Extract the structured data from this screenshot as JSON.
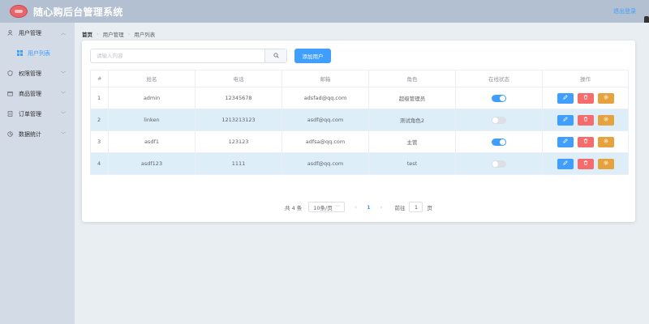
{
  "header": {
    "title": "随心购后台管理系统",
    "logout_label": "退出登录"
  },
  "sidebar": {
    "items": [
      {
        "label": "用户管理",
        "icon": "user-icon",
        "expanded": true,
        "children": [
          {
            "label": "用户列表",
            "icon": "grid-icon",
            "active": true
          }
        ]
      },
      {
        "label": "权限管理",
        "icon": "shield-icon"
      },
      {
        "label": "商品管理",
        "icon": "box-icon"
      },
      {
        "label": "订单管理",
        "icon": "document-icon"
      },
      {
        "label": "数据统计",
        "icon": "chart-icon"
      }
    ]
  },
  "breadcrumb": {
    "home": "首页",
    "level1": "用户管理",
    "level2": "用户列表"
  },
  "search": {
    "placeholder": "请输入内容",
    "value": ""
  },
  "add_button_label": "添加用户",
  "table": {
    "columns": [
      "#",
      "姓名",
      "电话",
      "邮箱",
      "角色",
      "在线状态",
      "操作"
    ],
    "rows": [
      {
        "index": "1",
        "name": "admin",
        "phone": "12345678",
        "email": "adsfad@qq.com",
        "role": "超级管理员",
        "online": true
      },
      {
        "index": "2",
        "name": "linken",
        "phone": "1213213123",
        "email": "asdf@qq.com",
        "role": "测试角色2",
        "online": false
      },
      {
        "index": "3",
        "name": "asdf1",
        "phone": "123123",
        "email": "adfsa@qq.com",
        "role": "主管",
        "online": true
      },
      {
        "index": "4",
        "name": "asdf123",
        "phone": "1111",
        "email": "asdf@qq.com",
        "role": "test",
        "online": false
      }
    ]
  },
  "pagination": {
    "total_text": "共 4 条",
    "page_size_text": "10条/页",
    "current_page": "1",
    "goto_label": "前往",
    "goto_value": "1",
    "page_unit": "页"
  },
  "colors": {
    "header_bg": "#b3c0d1",
    "sidebar_bg": "#d3dce6",
    "main_bg": "#e9eef3",
    "primary": "#409eff",
    "danger": "#f56c6c",
    "warning": "#e6a23c",
    "stripe": "#ddeef9"
  }
}
